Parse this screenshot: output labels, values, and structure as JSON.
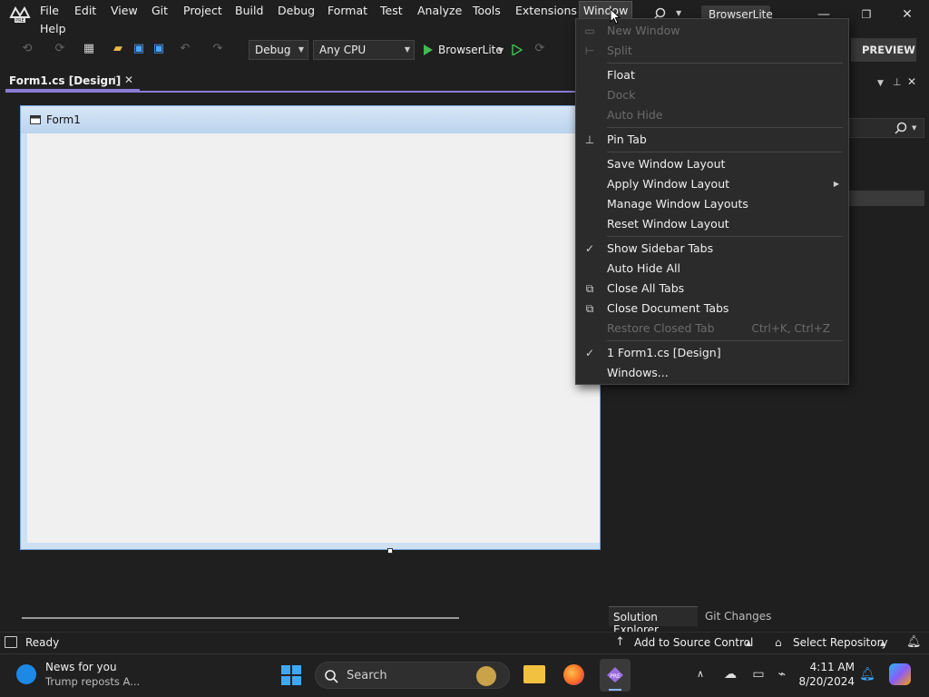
{
  "menubar": {
    "items": [
      "File",
      "Edit",
      "View",
      "Git",
      "Project",
      "Build",
      "Debug",
      "Format",
      "Test",
      "Analyze",
      "Tools",
      "Extensions",
      "Window",
      "Help"
    ],
    "solution_name": "BrowserLite",
    "search_icon": "search-icon"
  },
  "toolbar": {
    "config": "Debug",
    "platform": "Any CPU",
    "run_target": "BrowserLite",
    "preview_label": "PREVIEW"
  },
  "document": {
    "tab_label": "Form1.cs [Design]",
    "form_title": "Form1"
  },
  "window_menu": {
    "items": [
      {
        "label": "New Window",
        "disabled": true
      },
      {
        "label": "Split",
        "disabled": true
      },
      {
        "label": "Float",
        "disabled": false
      },
      {
        "label": "Dock",
        "disabled": true
      },
      {
        "label": "Auto Hide",
        "disabled": true
      },
      {
        "label": "Pin Tab",
        "disabled": false
      },
      {
        "label": "Save Window Layout",
        "disabled": false
      },
      {
        "label": "Apply Window Layout",
        "disabled": false,
        "submenu": true
      },
      {
        "label": "Manage Window Layouts",
        "disabled": false
      },
      {
        "label": "Reset Window Layout",
        "disabled": false
      },
      {
        "label": "Show Sidebar Tabs",
        "disabled": false,
        "checked": true
      },
      {
        "label": "Auto Hide All",
        "disabled": false
      },
      {
        "label": "Close All Tabs",
        "disabled": false
      },
      {
        "label": "Close Document Tabs",
        "disabled": false
      },
      {
        "label": "Restore Closed Tab",
        "disabled": true,
        "shortcut": "Ctrl+K, Ctrl+Z"
      },
      {
        "label": "1 Form1.cs [Design]",
        "disabled": false,
        "checked": true
      },
      {
        "label": "Windows...",
        "disabled": false
      }
    ]
  },
  "right_panel": {
    "tabs": [
      "Solution Explorer",
      "Git Changes"
    ]
  },
  "statusbar": {
    "status": "Ready",
    "source_control": "Add to Source Control",
    "repository": "Select Repository"
  },
  "taskbar": {
    "news_title": "News for you",
    "news_sub": "Trump reposts A...",
    "search_placeholder": "Search",
    "time": "4:11 AM",
    "date": "8/20/2024"
  },
  "colors": {
    "accent": "#8a7bd6",
    "bg": "#1f1f1f",
    "menu_bg": "#2b2b2b",
    "run_green": "#3fb950"
  }
}
